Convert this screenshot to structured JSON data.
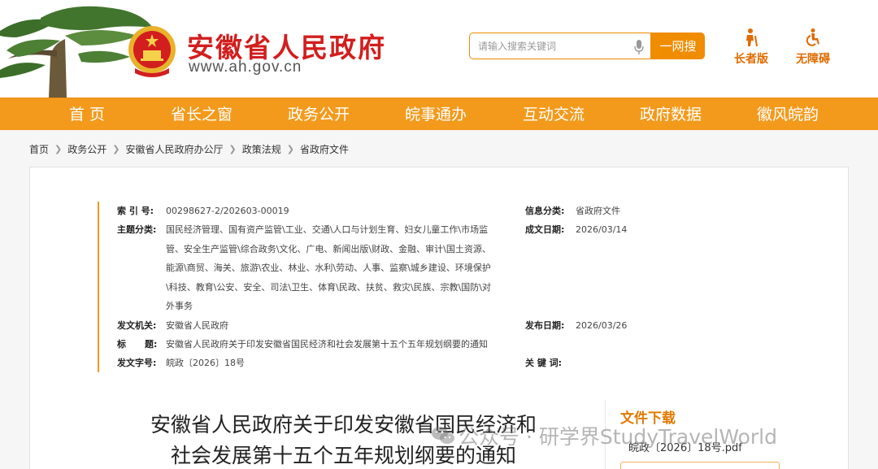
{
  "header": {
    "site_title": "安徽省人民政府",
    "site_url": "www.ah.gov.cn",
    "search": {
      "placeholder": "请输入搜索关键词",
      "button_label": "一网搜"
    },
    "tools": [
      {
        "label": "长者版",
        "icon": "elderly-icon"
      },
      {
        "label": "无障碍",
        "icon": "accessibility-icon"
      }
    ]
  },
  "nav": {
    "items": [
      "首 页",
      "省长之窗",
      "政务公开",
      "皖事通办",
      "互动交流",
      "政府数据",
      "徽风皖韵"
    ],
    "active_index": 2
  },
  "breadcrumb": [
    "首页",
    "政务公开",
    "安徽省人民政府办公厅",
    "政策法规",
    "省政府文件"
  ],
  "meta": {
    "index_label": "索 引 号:",
    "index_value": "00298627-2/202603-00019",
    "info_category_label": "信息分类:",
    "info_category_value": "省政府文件",
    "topic_label": "主题分类:",
    "topic_lines": [
      "国民经济管理、国有资产监管\\工业、交通\\人口与计划生育、妇女儿童工作\\市场监",
      "管、安全生产监管\\综合政务\\文化、广电、新闻出版\\财政、金融、审计\\国土资源、",
      "能源\\商贸、海关、旅游\\农业、林业、水利\\劳动、人事、监察\\城乡建设、环境保护",
      "\\科技、教育\\公安、安全、司法\\卫生、体育\\民政、扶贫、救灾\\民族、宗教\\国防\\对",
      "外事务"
    ],
    "created_label": "成文日期:",
    "created_value": "2026/03/14",
    "issuer_label": "发文机关:",
    "issuer_value": "安徽省人民政府",
    "published_label": "发布日期:",
    "published_value": "2026/03/26",
    "title_label": "标      题:",
    "title_value": "安徽省人民政府关于印发安徽省国民经济和社会发展第十五个五年规划纲要的通知",
    "doc_no_label": "发文字号:",
    "doc_no_value": "皖政〔2026〕18号",
    "keywords_label": "关 键 词:",
    "keywords_value": ""
  },
  "document": {
    "title_line1": "安徽省人民政府关于印发安徽省国民经济和",
    "title_line2": "社会发展第十五个五年规划纲要的通知"
  },
  "download": {
    "title": "文件下载",
    "file_name": "皖政〔2026〕18号.pdf"
  },
  "watermark": {
    "text": "公众号 · 研学界StudyTravelWorld"
  },
  "colors": {
    "brand_red": "#d21e1e",
    "nav_orange": "#f39a1c",
    "accent_orange": "#f08c00"
  }
}
